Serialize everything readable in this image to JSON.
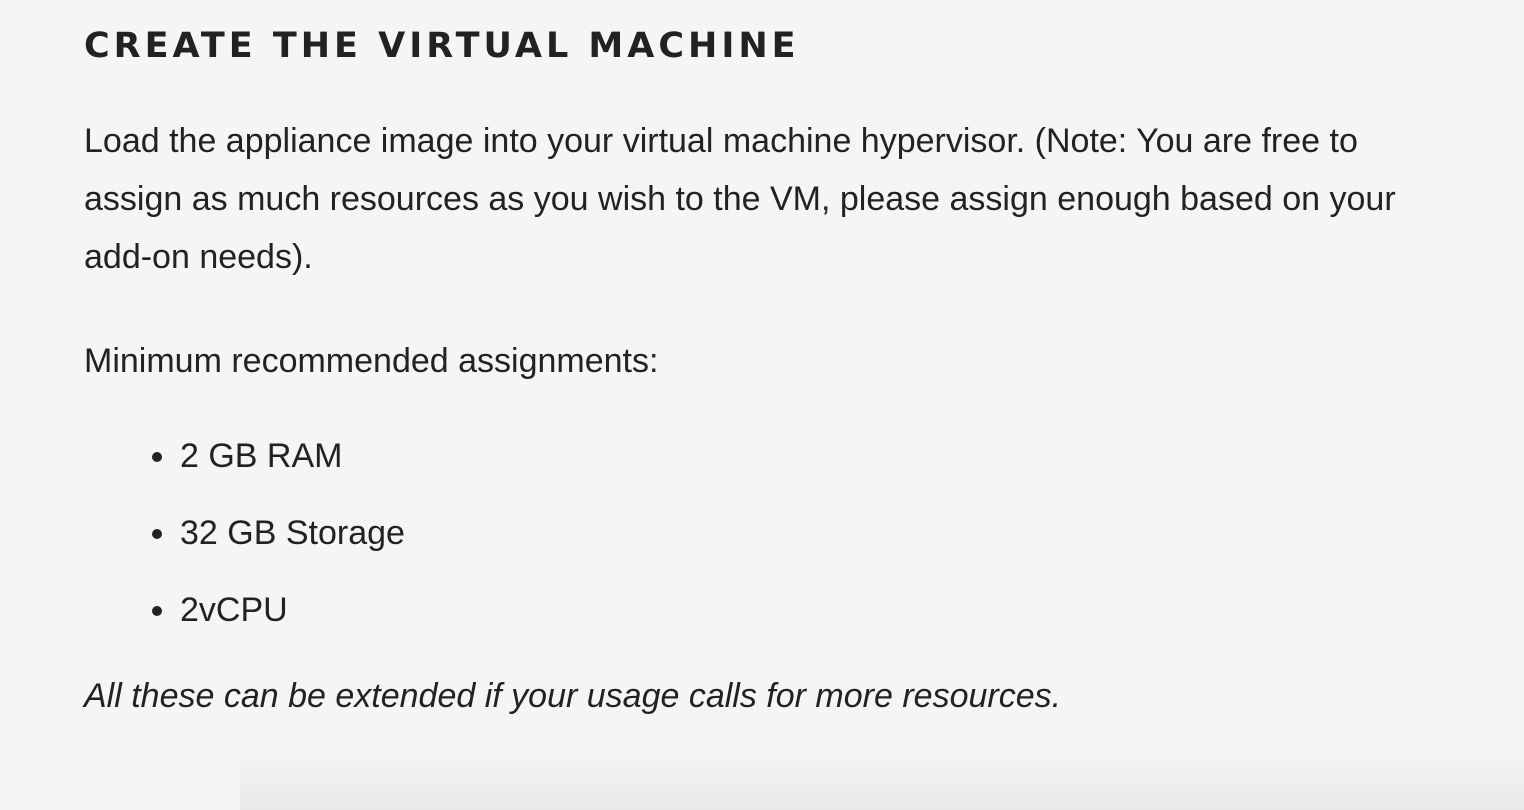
{
  "section": {
    "heading": "CREATE THE VIRTUAL MACHINE",
    "intro": "Load the appliance image into your virtual machine hypervisor. (Note: You are free to assign as much resources as you wish to the VM, please assign enough based on your add-on needs).",
    "min_label": "Minimum recommended assignments:",
    "specs": [
      "2 GB RAM",
      "32 GB Storage",
      "2vCPU"
    ],
    "note": "All these can be extended if your usage calls for more resources."
  }
}
